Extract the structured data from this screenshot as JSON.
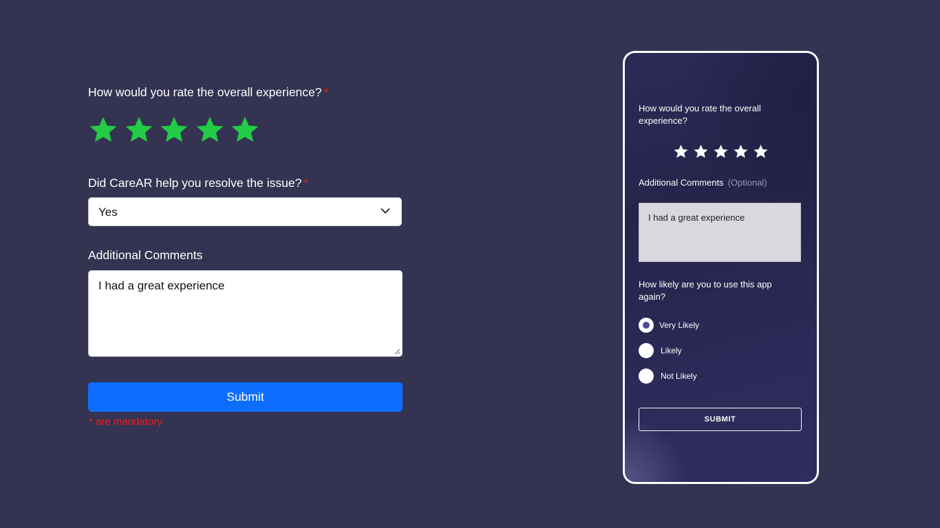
{
  "form": {
    "rating_question": "How would you rate the overall experience?",
    "required_mark": "*",
    "rating_value": 5,
    "rating_max": 5,
    "star_color": "#22cc44",
    "resolve_question": "Did CareAR help you resolve the issue?",
    "resolve_selected": "Yes",
    "comments_label": "Additional Comments",
    "comments_value": "I had a great experience",
    "submit_label": "Submit",
    "mandatory_note": "* are mandatory",
    "accent_color": "#0d6efd",
    "required_color": "#e62020"
  },
  "phone": {
    "rating_question": "How would you rate the overall experience?",
    "rating_value": 5,
    "comments_label": "Additional Comments",
    "comments_optional": "(Optional)",
    "comments_value": "I had a great experience",
    "likely_question": "How likely are you to use this app again?",
    "options": [
      "Very Likely",
      "Likely",
      "Not Likely"
    ],
    "selected_option": "Very Likely",
    "submit_label": "SUBMIT"
  }
}
